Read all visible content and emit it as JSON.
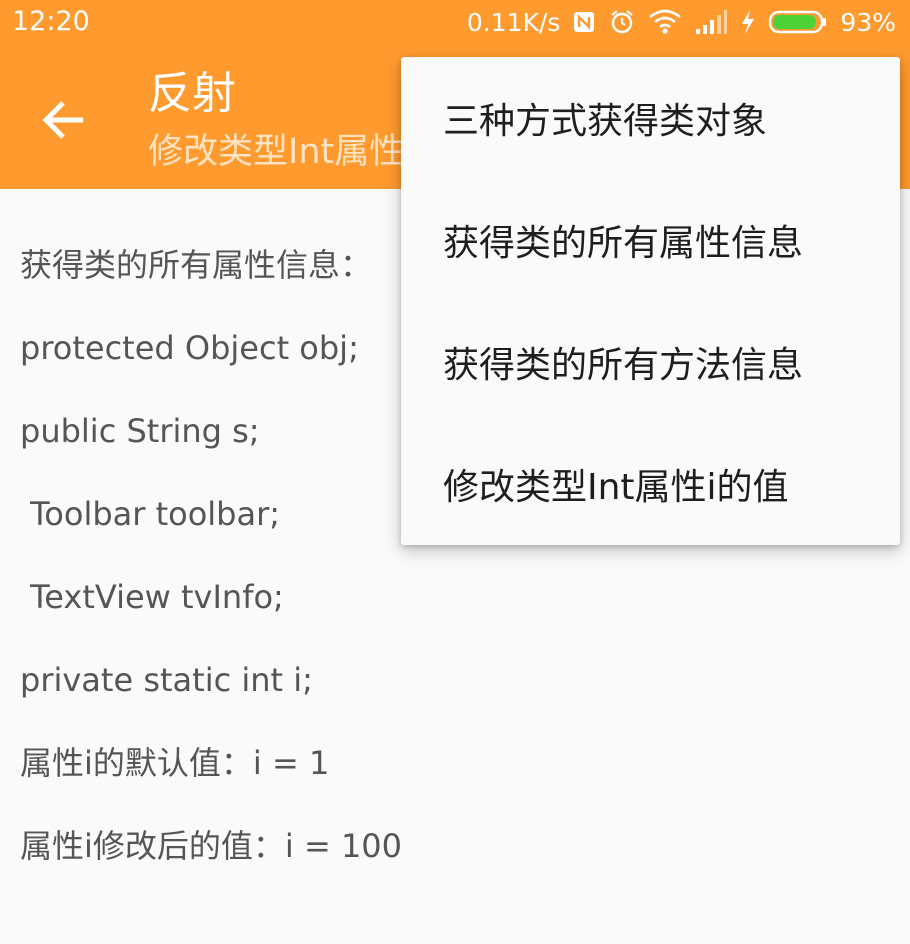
{
  "status_bar": {
    "time": "12:20",
    "net_speed": "0.11K/s",
    "battery_percent": "93%",
    "battery_level": 0.93,
    "icons": [
      "nfc-icon",
      "alarm-icon",
      "wifi-icon",
      "signal-icon",
      "charging-icon",
      "battery-icon"
    ]
  },
  "toolbar": {
    "title": "反射",
    "subtitle": "修改类型Int属性i的值",
    "back_icon": "arrow-back-icon",
    "background_color": "#FF9A2E"
  },
  "content": {
    "lines": [
      "获得类的所有属性信息：",
      "protected Object obj;",
      "public String s;",
      " Toolbar toolbar;",
      " TextView tvInfo;",
      "private static int i;",
      "属性i的默认值：i = 1",
      "属性i修改后的值：i = 100"
    ]
  },
  "menu": {
    "items": [
      "三种方式获得类对象",
      "获得类的所有属性信息",
      "获得类的所有方法信息",
      "修改类型Int属性i的值"
    ]
  }
}
